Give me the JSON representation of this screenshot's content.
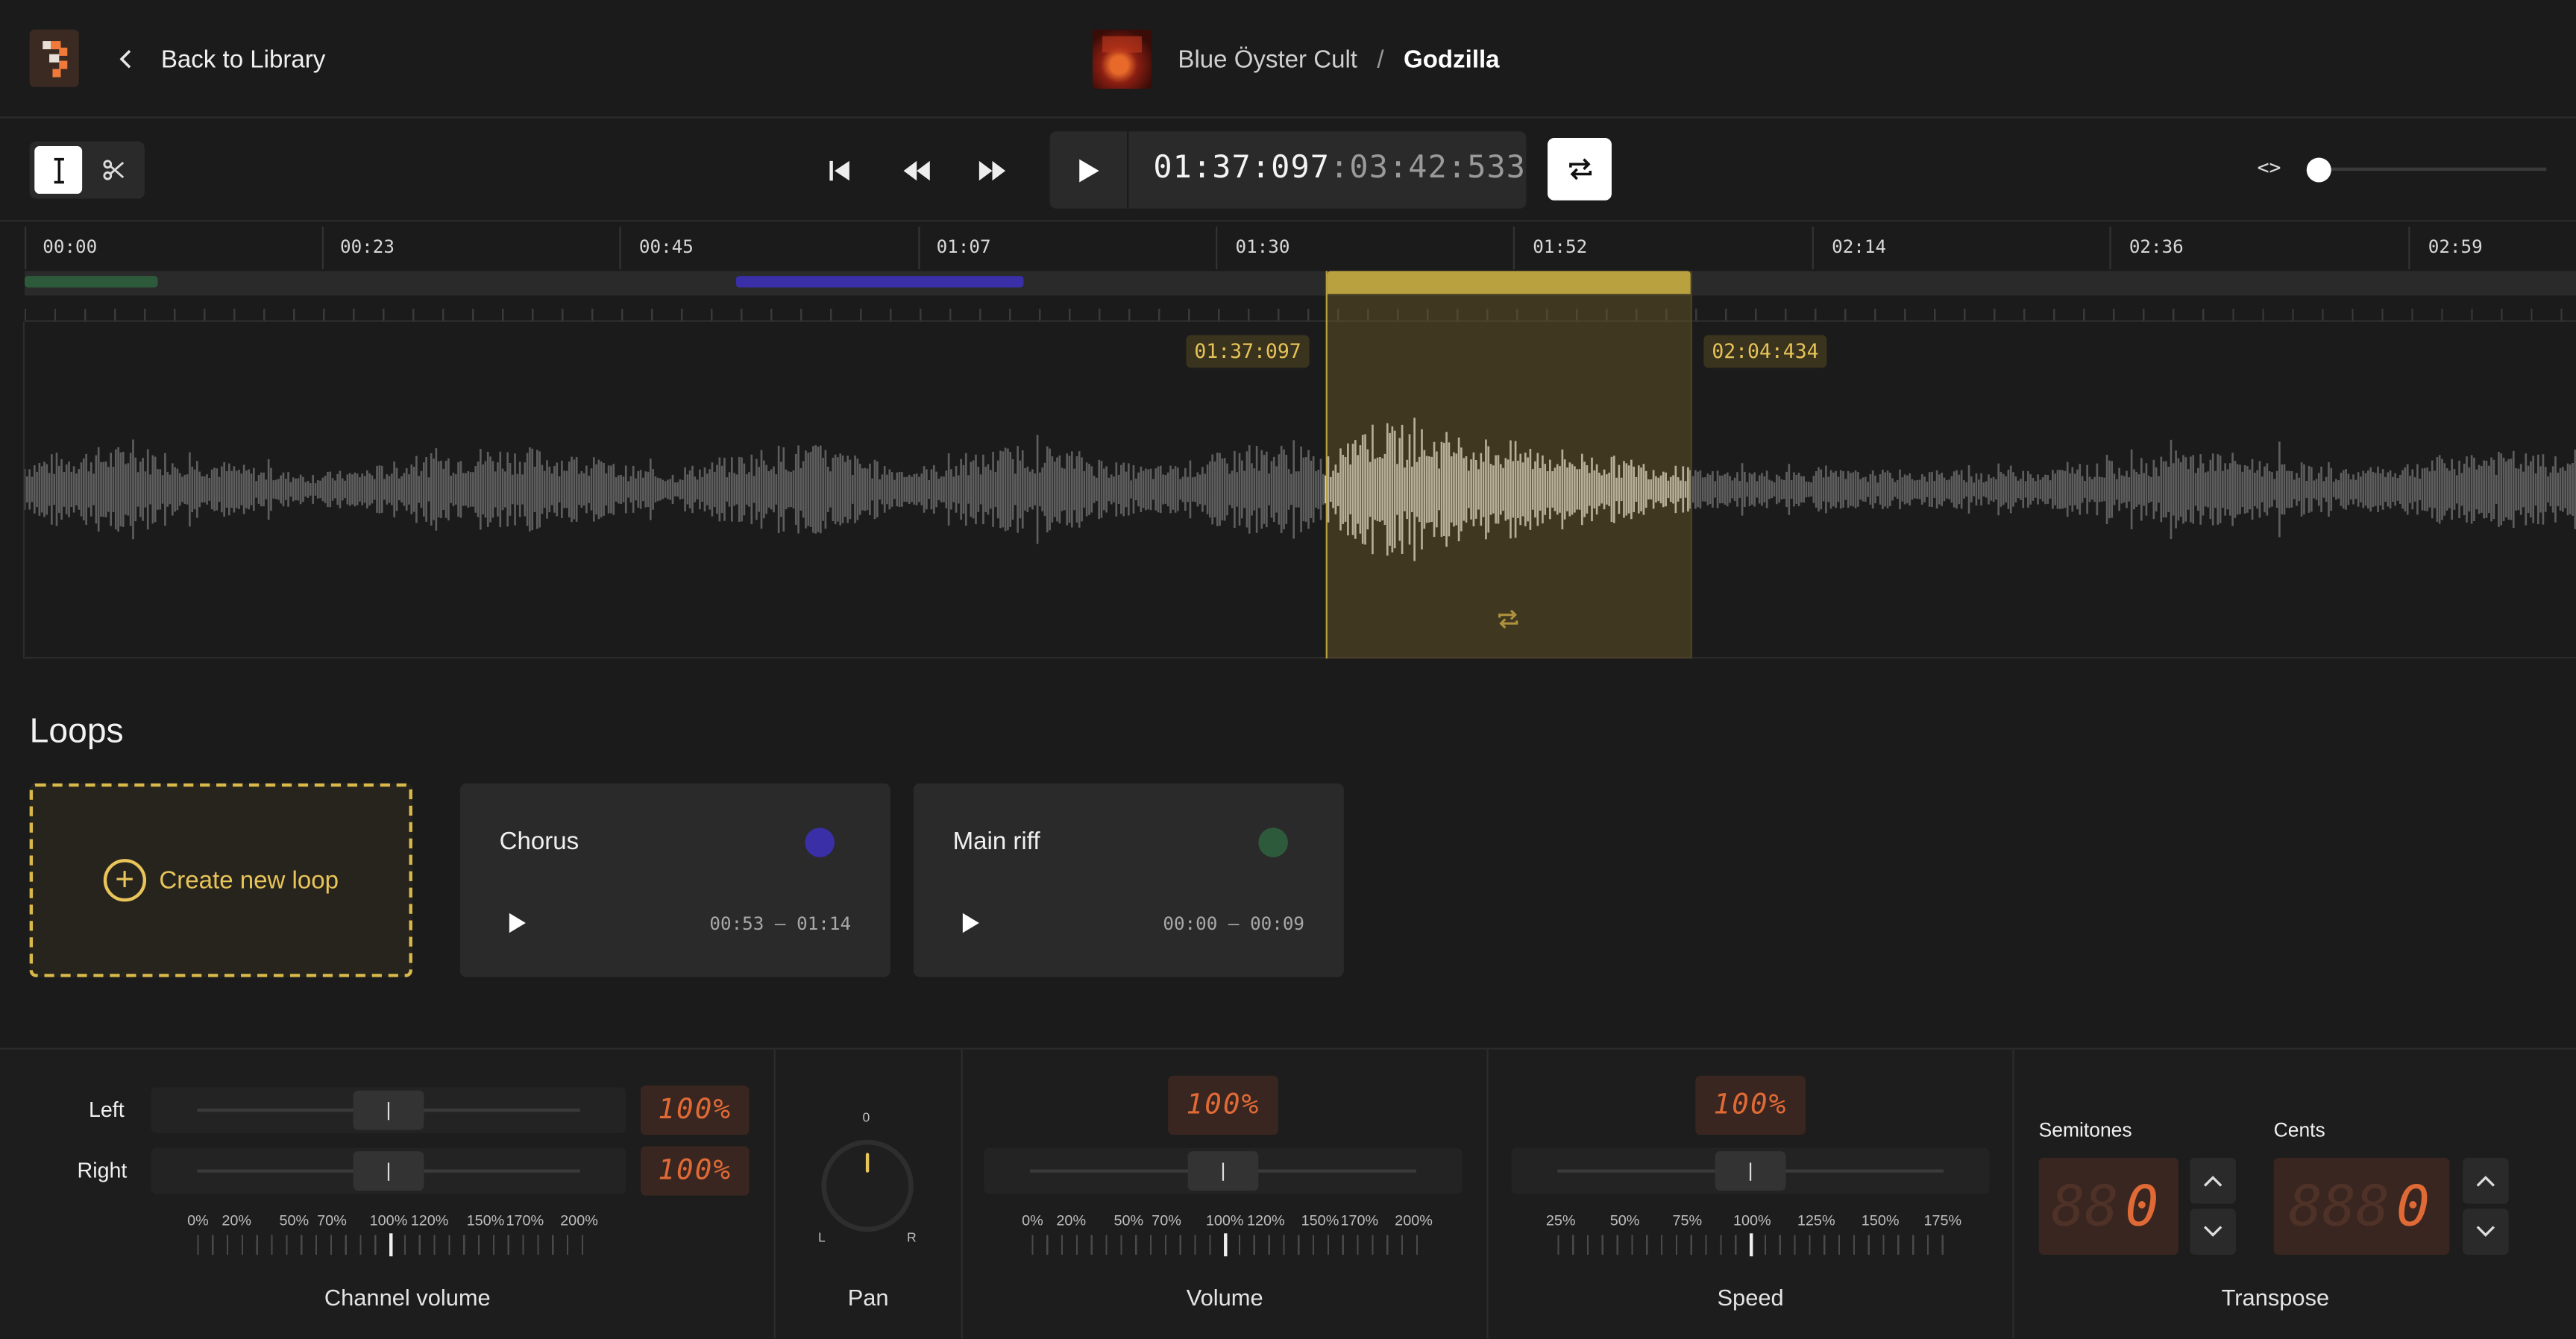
{
  "header": {
    "back_label": "Back to Library",
    "artist": "Blue Öyster Cult",
    "separator": "/",
    "song": "Godzilla"
  },
  "transport": {
    "current_time": "01:37:097",
    "total_time": "03:42:533"
  },
  "timeline": {
    "ticks": [
      "00:00",
      "00:23",
      "00:45",
      "01:07",
      "01:30",
      "01:52",
      "02:14",
      "02:36",
      "02:59"
    ],
    "selection_start": "01:37:097",
    "selection_end": "02:04:434"
  },
  "loops": {
    "title": "Loops",
    "create_label": "Create new loop",
    "items": [
      {
        "name": "Chorus",
        "range": "00:53 – 01:14",
        "color": "#3b2fa8"
      },
      {
        "name": "Main riff",
        "range": "00:00 – 00:09",
        "color": "#2e5a3c"
      }
    ]
  },
  "channel_volume": {
    "label": "Channel volume",
    "left_label": "Left",
    "right_label": "Right",
    "left_value": "100%",
    "right_value": "100%",
    "scale": [
      "0%",
      "20%",
      "50%",
      "70%",
      "100%",
      "120%",
      "150%",
      "170%",
      "200%"
    ]
  },
  "pan": {
    "label": "Pan",
    "center": "0",
    "left": "L",
    "right": "R"
  },
  "volume": {
    "label": "Volume",
    "value": "100%",
    "scale": [
      "0%",
      "20%",
      "50%",
      "70%",
      "100%",
      "120%",
      "150%",
      "170%",
      "200%"
    ]
  },
  "speed": {
    "label": "Speed",
    "value": "100%",
    "scale": [
      "25%",
      "50%",
      "75%",
      "100%",
      "125%",
      "150%",
      "175%"
    ]
  },
  "transpose": {
    "label": "Transpose",
    "semitones_label": "Semitones",
    "cents_label": "Cents",
    "semitones_dim": "88",
    "semitones_value": "0",
    "cents_dim": "888",
    "cents_value": "0"
  },
  "colors": {
    "accent": "#e8c45a",
    "selection": "#b9a13f",
    "lcd": "#e06a35"
  }
}
